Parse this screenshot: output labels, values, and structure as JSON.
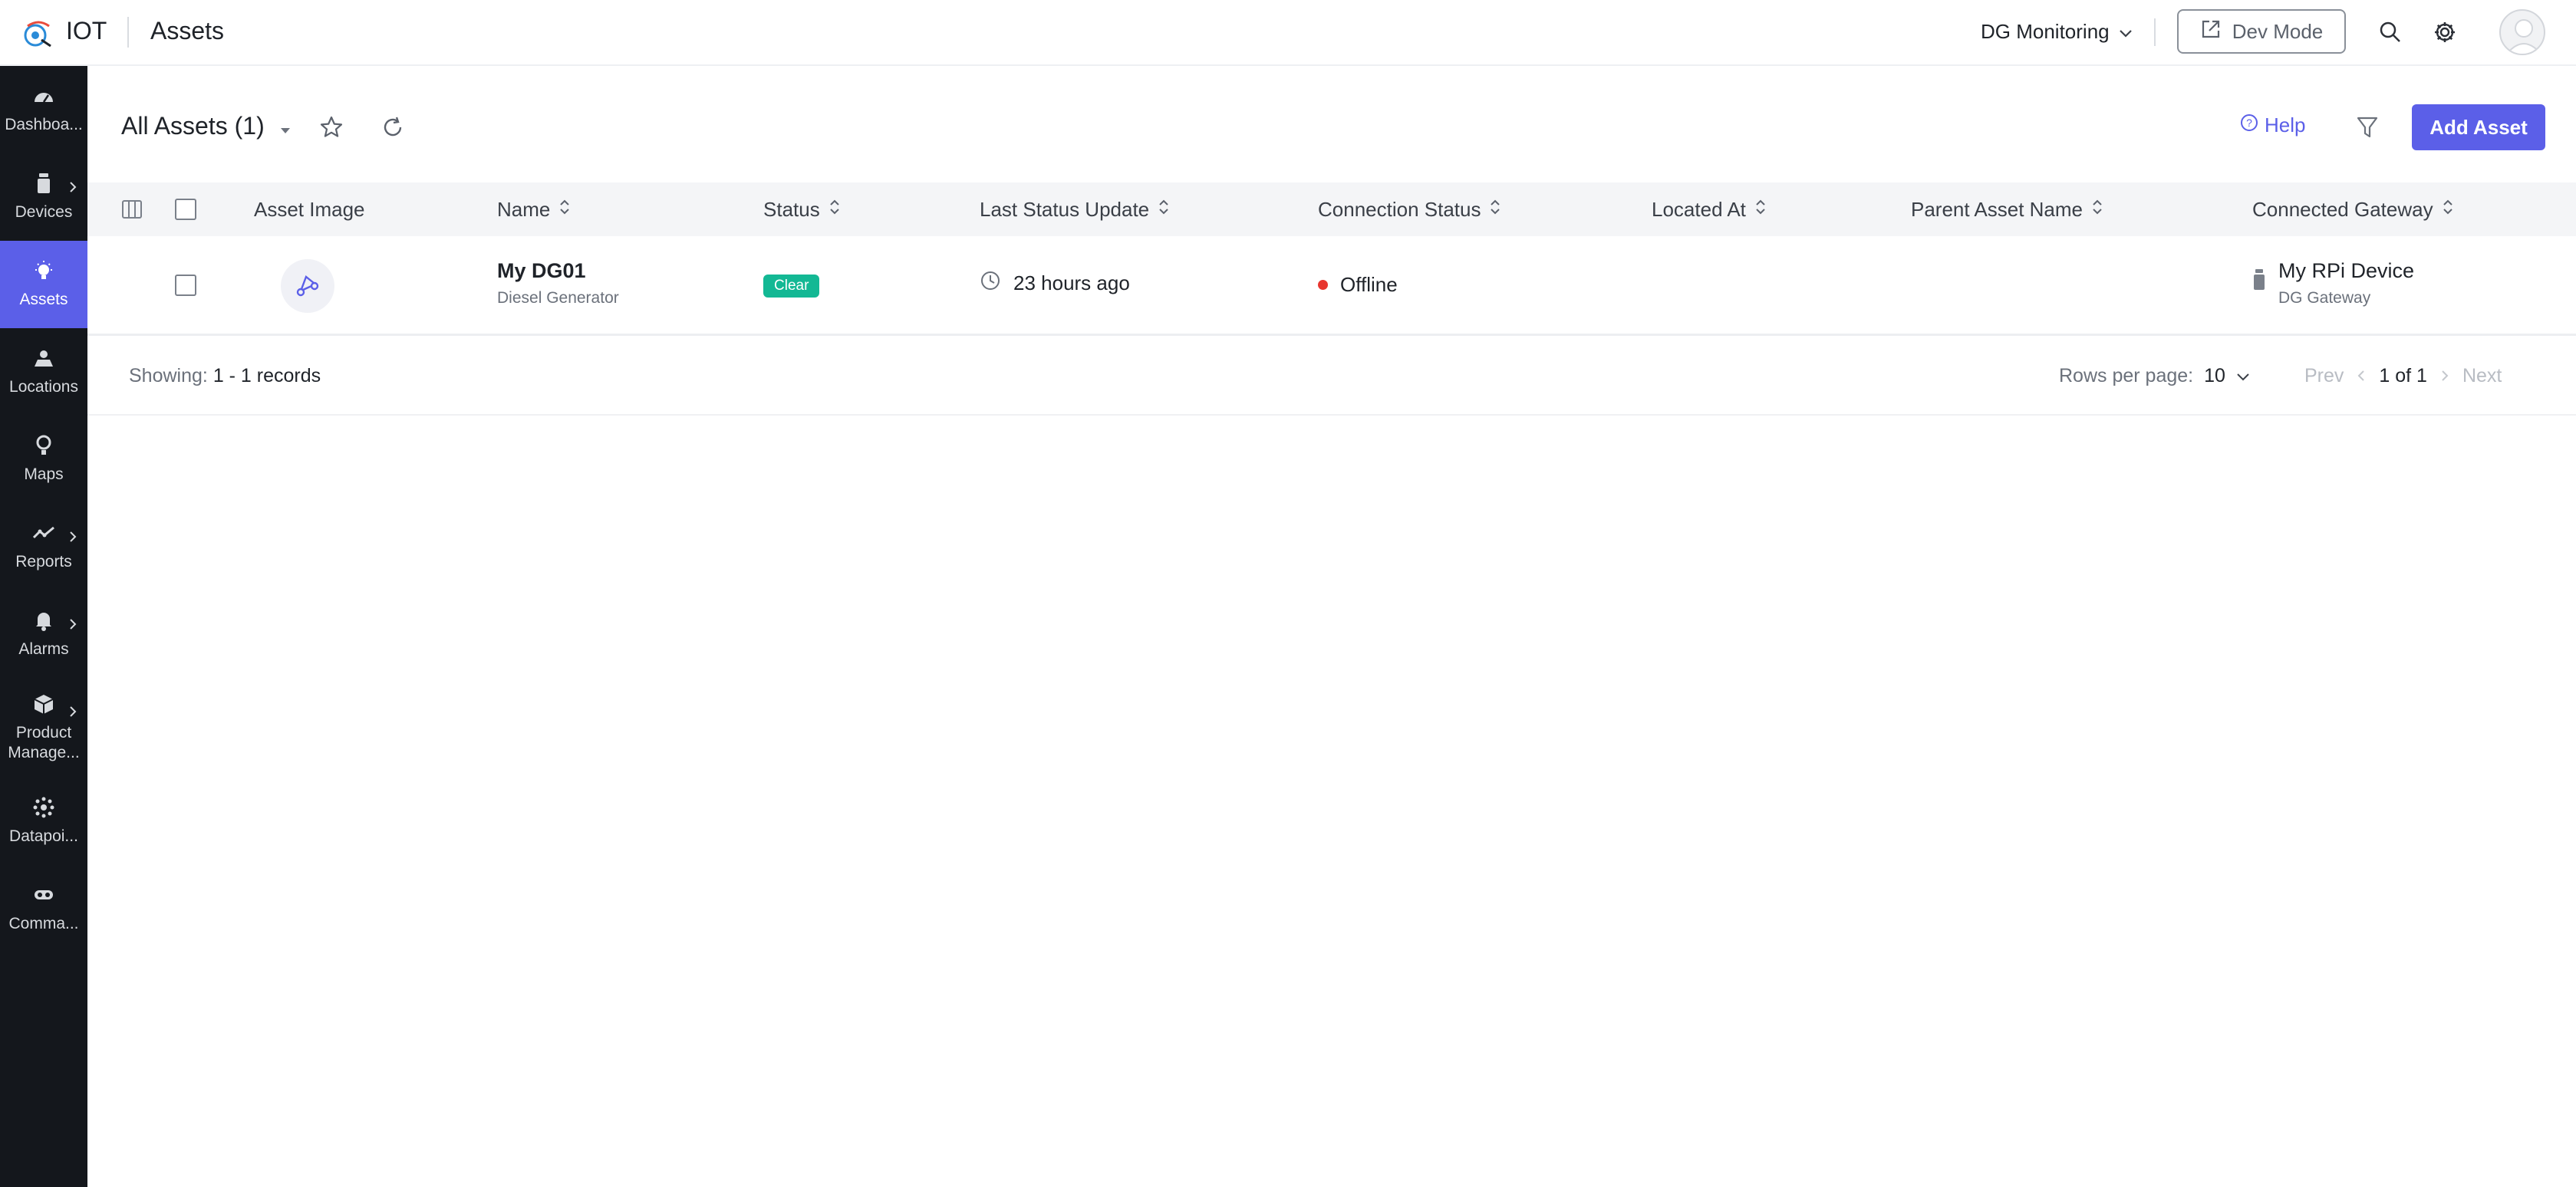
{
  "topbar": {
    "brand": "IOT",
    "title": "Assets",
    "app_name": "DG Monitoring",
    "dev_mode_label": "Dev Mode"
  },
  "sidebar": {
    "items": [
      {
        "label": "Dashboa...",
        "icon": "dashboard-icon",
        "active": false,
        "has_submenu": false
      },
      {
        "label": "Devices",
        "icon": "device-icon",
        "active": false,
        "has_submenu": true
      },
      {
        "label": "Assets",
        "icon": "asset-bulb-icon",
        "active": true,
        "has_submenu": false
      },
      {
        "label": "Locations",
        "icon": "location-icon",
        "active": false,
        "has_submenu": false
      },
      {
        "label": "Maps",
        "icon": "map-pin-icon",
        "active": false,
        "has_submenu": false
      },
      {
        "label": "Reports",
        "icon": "reports-icon",
        "active": false,
        "has_submenu": true
      },
      {
        "label": "Alarms",
        "icon": "bell-icon",
        "active": false,
        "has_submenu": true
      },
      {
        "label": "Product Manage...",
        "icon": "box-icon",
        "active": false,
        "has_submenu": true
      },
      {
        "label": "Datapoi...",
        "icon": "datapoint-icon",
        "active": false,
        "has_submenu": false
      },
      {
        "label": "Comma...",
        "icon": "command-icon",
        "active": false,
        "has_submenu": false
      }
    ]
  },
  "view": {
    "title": "All Assets (1)",
    "help_label": "Help",
    "add_button_label": "Add Asset"
  },
  "table": {
    "columns": [
      "Asset Image",
      "Name",
      "Status",
      "Last Status Update",
      "Connection Status",
      "Located At",
      "Parent Asset Name",
      "Connected Gateway"
    ],
    "rows": [
      {
        "name": "My DG01",
        "type": "Diesel Generator",
        "status": "Clear",
        "last_update": "23 hours ago",
        "connection": "Offline",
        "located_at": "",
        "parent": "",
        "gateway_name": "My RPi Device",
        "gateway_type": "DG Gateway"
      }
    ]
  },
  "footer": {
    "showing_label": "Showing:",
    "showing_value": "1 - 1 records",
    "rows_per_page_label": "Rows per page:",
    "rows_per_page_value": "10",
    "prev_label": "Prev",
    "page_info": "1 of 1",
    "next_label": "Next"
  },
  "colors": {
    "accent": "#5b5fe8",
    "sidebar_bg": "#14171c",
    "status_clear": "#13b894",
    "offline_dot": "#e8362f"
  }
}
